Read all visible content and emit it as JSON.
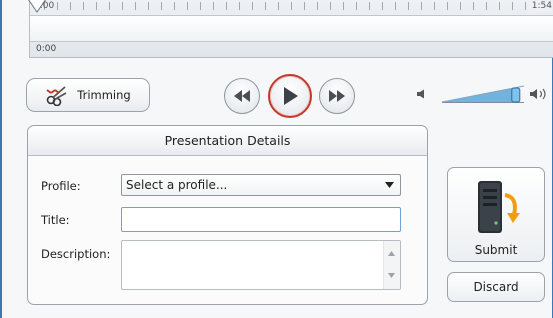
{
  "timeline": {
    "start_label": "0:00",
    "end_label": "1:54",
    "position_label": "0:00",
    "playhead_fraction": 0
  },
  "toolbar": {
    "trimming_label": "Trimming",
    "volume_level": 0.9
  },
  "details": {
    "header": "Presentation Details",
    "profile_label": "Profile:",
    "profile_value": "Select a profile...",
    "title_label": "Title:",
    "title_value": "",
    "description_label": "Description:",
    "description_value": ""
  },
  "actions": {
    "submit_label": "Submit",
    "discard_label": "Discard"
  },
  "icons": {
    "trim": "scissors-icon",
    "rewind": "rewind-icon",
    "play": "play-icon",
    "fast_forward": "fast-forward-icon",
    "volume_low": "speaker-low-icon",
    "volume_high": "speaker-high-icon",
    "submit": "server-upload-icon"
  },
  "colors": {
    "accent_border": "#3b78b5",
    "play_ring": "#c0392b",
    "volume_fill": "#5aa6d8",
    "submit_arrow": "#f39c12"
  }
}
